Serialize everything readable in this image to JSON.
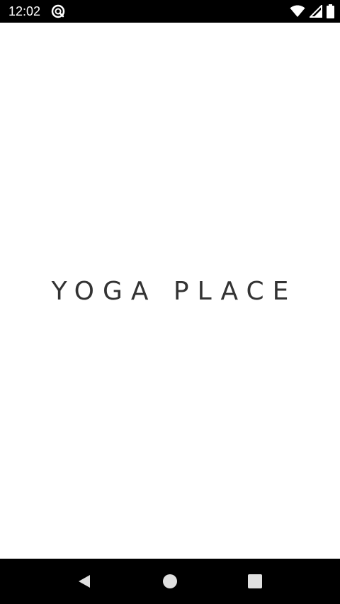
{
  "status_bar": {
    "time": "12:02",
    "app_icon": "notification-app-icon",
    "icons": [
      "wifi-icon",
      "cell-signal-icon",
      "battery-icon"
    ]
  },
  "splash": {
    "logo_text": "YOGA PLACE"
  },
  "nav_bar": {
    "buttons": [
      "back-icon",
      "home-icon",
      "recents-icon"
    ]
  },
  "colors": {
    "status_bar_bg": "#000000",
    "nav_bar_bg": "#000000",
    "page_bg": "#ffffff",
    "logo_text": "#333333",
    "nav_icon": "#e0e0e0"
  }
}
